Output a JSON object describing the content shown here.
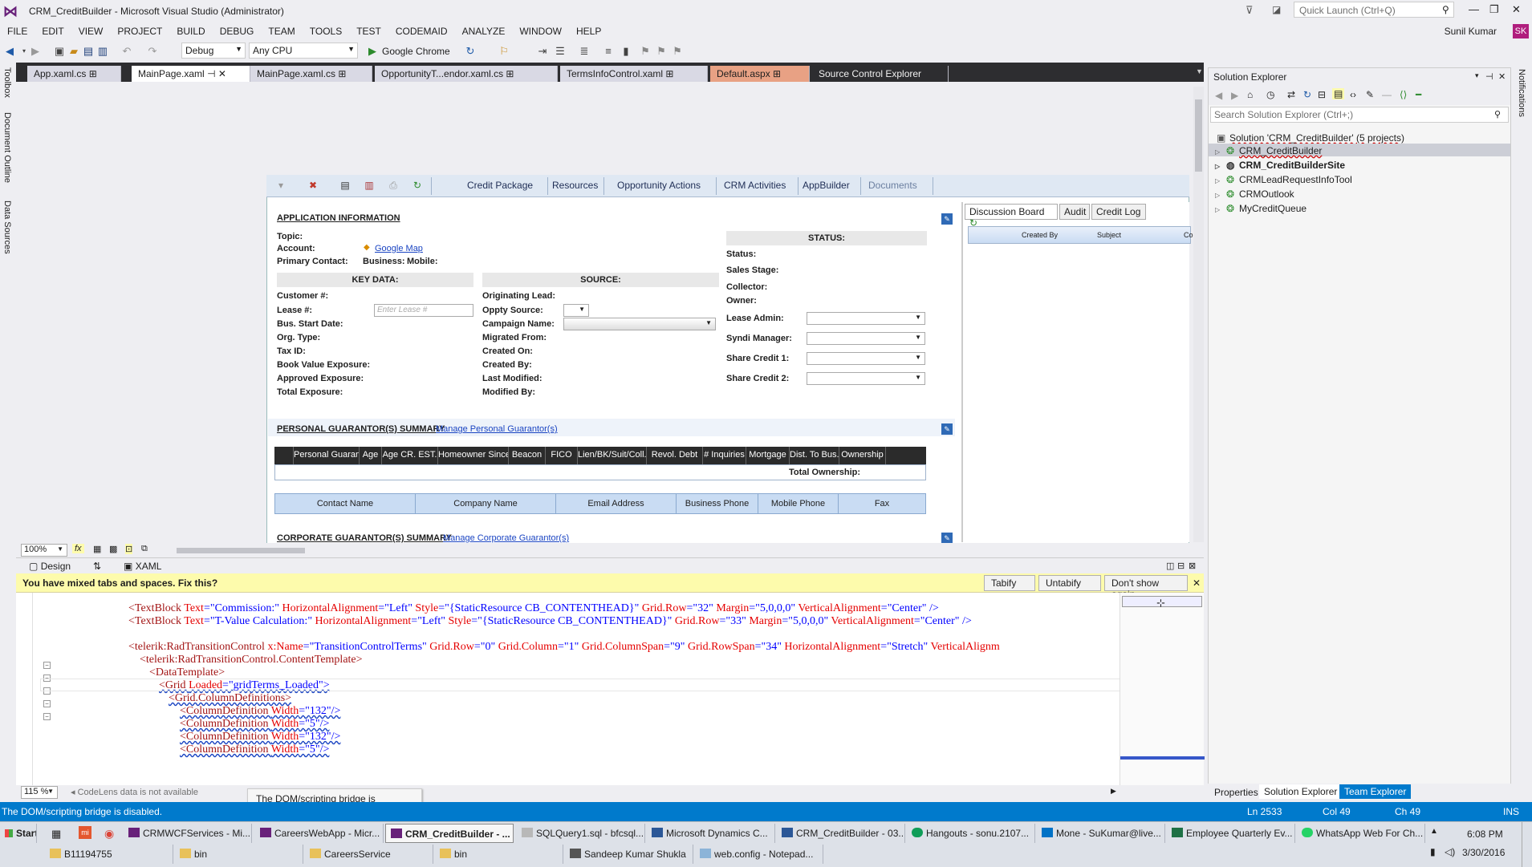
{
  "window": {
    "title": "CRM_CreditBuilder - Microsoft Visual Studio (Administrator)",
    "quick_launch_placeholder": "Quick Launch (Ctrl+Q)",
    "user": "Sunil Kumar",
    "user_initials": "SK"
  },
  "menu": [
    "FILE",
    "EDIT",
    "VIEW",
    "PROJECT",
    "BUILD",
    "DEBUG",
    "TEAM",
    "TOOLS",
    "TEST",
    "CODEMAID",
    "ANALYZE",
    "WINDOW",
    "HELP"
  ],
  "toolbar": {
    "config": "Debug",
    "platform": "Any CPU",
    "run_target": "Google Chrome"
  },
  "left_strip": [
    "Toolbox",
    "Document Outline",
    "Data Sources"
  ],
  "right_strip": [
    "Notifications"
  ],
  "doc_tabs": [
    "App.xaml.cs",
    "MainPage.xaml",
    "MainPage.xaml.cs",
    "OpportunityT...endor.xaml.cs",
    "TermsInfoControl.xaml",
    "Default.aspx",
    "Source Control Explorer"
  ],
  "ribbon": [
    "Credit Package",
    "Resources",
    "Opportunity Actions",
    "CRM Activities",
    "AppBuilder",
    "Documents"
  ],
  "app_info": {
    "title": "APPLICATION INFORMATION",
    "topic": "Topic:",
    "account": "Account:",
    "google_map": "Google Map",
    "primary_contact": "Primary Contact:",
    "business": "Business:",
    "mobile": "Mobile:",
    "status_header": "STATUS:",
    "status_fields": [
      "Status:",
      "Sales Stage:",
      "Collector:",
      "Owner:",
      "Lease Admin:",
      "Syndi Manager:",
      "Share Credit 1:",
      "Share Credit 2:"
    ],
    "key_data_header": "KEY DATA:",
    "key_data_fields": [
      "Customer #:",
      "Lease #:",
      "Bus. Start Date:",
      "Org. Type:",
      "Tax ID:",
      "Book Value Exposure:",
      "Approved Exposure:",
      "Total Exposure:"
    ],
    "lease_placeholder": "Enter Lease #",
    "source_header": "SOURCE:",
    "source_fields": [
      "Originating Lead:",
      "Oppty Source:",
      "Campaign Name:",
      "Migrated From:",
      "Created On:",
      "Created By:",
      "Last Modified:",
      "Modified By:"
    ]
  },
  "guarantors": {
    "personal_title": "PERSONAL GUARANTOR(S) SUMMARY",
    "personal_link": "Manage Personal Guarantor(s)",
    "personal_cols": [
      "Personal Guarantor",
      "Age",
      "Age CR. EST.",
      "Homeowner Since",
      "Beacon",
      "FICO",
      "Lien/BK/Suit/Coll.",
      "Revol. Debt",
      "# Inquiries",
      "Mortgage",
      "Dist. To Bus.",
      "Ownership"
    ],
    "total_ownership": "Total Ownership:",
    "contact_cols": [
      "Contact Name",
      "Company Name",
      "Email Address",
      "Business Phone",
      "Mobile Phone",
      "Fax"
    ],
    "corporate_title": "CORPORATE GUARANTOR(S) SUMMARY",
    "corporate_link": "Manage Corporate Guarantor(s)"
  },
  "right_panel": {
    "tabs": [
      "Discussion Board",
      "Audit",
      "Credit Log"
    ],
    "cols": [
      "Created By",
      "Subject",
      "Co"
    ]
  },
  "designer": {
    "zoom": "100%",
    "design_tab": "Design",
    "xaml_tab": "XAML"
  },
  "infobar": {
    "message": "You have mixed tabs and spaces. Fix this?",
    "tabify": "Tabify",
    "untabify": "Untabify",
    "dont_show": "Don't show again"
  },
  "code_lines": [
    {
      "indent": 140,
      "parts": [
        [
          "tg",
          "<TextBlock "
        ],
        [
          "at",
          "Text"
        ],
        [
          "bl",
          "=\""
        ],
        [
          "vl",
          "Commission:"
        ],
        [
          "bl",
          "\" "
        ],
        [
          "at",
          "HorizontalAlignment"
        ],
        [
          "bl",
          "=\""
        ],
        [
          "vl",
          "Left"
        ],
        [
          "bl",
          "\" "
        ],
        [
          "at",
          "Style"
        ],
        [
          "bl",
          "=\""
        ],
        [
          "vl",
          "{StaticResource CB_CONTENTHEAD}"
        ],
        [
          "bl",
          "\" "
        ],
        [
          "at",
          "Grid.Row"
        ],
        [
          "bl",
          "=\""
        ],
        [
          "vl",
          "32"
        ],
        [
          "bl",
          "\" "
        ],
        [
          "at",
          "Margin"
        ],
        [
          "bl",
          "=\""
        ],
        [
          "vl",
          "5,0,0,0"
        ],
        [
          "bl",
          "\" "
        ],
        [
          "at",
          "VerticalAlignment"
        ],
        [
          "bl",
          "=\""
        ],
        [
          "vl",
          "Center"
        ],
        [
          "bl",
          "\" />"
        ]
      ]
    },
    {
      "indent": 140,
      "parts": [
        [
          "tg",
          "<TextBlock "
        ],
        [
          "at",
          "Text"
        ],
        [
          "bl",
          "=\""
        ],
        [
          "vl",
          "T-Value Calculation:"
        ],
        [
          "bl",
          "\" "
        ],
        [
          "at",
          "HorizontalAlignment"
        ],
        [
          "bl",
          "=\""
        ],
        [
          "vl",
          "Left"
        ],
        [
          "bl",
          "\" "
        ],
        [
          "at",
          "Style"
        ],
        [
          "bl",
          "=\""
        ],
        [
          "vl",
          "{StaticResource CB_CONTENTHEAD}"
        ],
        [
          "bl",
          "\" "
        ],
        [
          "at",
          "Grid.Row"
        ],
        [
          "bl",
          "=\""
        ],
        [
          "vl",
          "33"
        ],
        [
          "bl",
          "\" "
        ],
        [
          "at",
          "Margin"
        ],
        [
          "bl",
          "=\""
        ],
        [
          "vl",
          "5,0,0,0"
        ],
        [
          "bl",
          "\" "
        ],
        [
          "at",
          "VerticalAlignment"
        ],
        [
          "bl",
          "=\""
        ],
        [
          "vl",
          "Center"
        ],
        [
          "bl",
          "\" />"
        ]
      ]
    },
    {
      "indent": 140,
      "parts": []
    },
    {
      "indent": 140,
      "parts": [
        [
          "tg",
          "<telerik:RadTransitionControl "
        ],
        [
          "at",
          "x:Name"
        ],
        [
          "bl",
          "=\""
        ],
        [
          "vl",
          "TransitionControlTerms"
        ],
        [
          "bl",
          "\" "
        ],
        [
          "at",
          "Grid.Row"
        ],
        [
          "bl",
          "=\""
        ],
        [
          "vl",
          "0"
        ],
        [
          "bl",
          "\" "
        ],
        [
          "at",
          "Grid.Column"
        ],
        [
          "bl",
          "=\""
        ],
        [
          "vl",
          "1"
        ],
        [
          "bl",
          "\" "
        ],
        [
          "at",
          "Grid.ColumnSpan"
        ],
        [
          "bl",
          "=\""
        ],
        [
          "vl",
          "9"
        ],
        [
          "bl",
          "\" "
        ],
        [
          "at",
          "Grid.RowSpan"
        ],
        [
          "bl",
          "=\""
        ],
        [
          "vl",
          "34"
        ],
        [
          "bl",
          "\" "
        ],
        [
          "at",
          "HorizontalAlignment"
        ],
        [
          "bl",
          "=\""
        ],
        [
          "vl",
          "Stretch"
        ],
        [
          "bl",
          "\" "
        ],
        [
          "at",
          "VerticalAlignm"
        ]
      ]
    },
    {
      "indent": 154,
      "parts": [
        [
          "tg",
          "<telerik:RadTransitionControl.ContentTemplate>"
        ]
      ]
    },
    {
      "indent": 166,
      "parts": [
        [
          "tg",
          "<DataTemplate>"
        ]
      ]
    },
    {
      "indent": 178,
      "parts": [
        [
          "tg",
          "<Grid "
        ],
        [
          "at",
          "Loaded"
        ],
        [
          "bl",
          "=\""
        ],
        [
          "vl",
          "gridTerms_Loaded"
        ],
        [
          "bl",
          "\">"
        ]
      ]
    },
    {
      "indent": 190,
      "parts": [
        [
          "tg",
          "<Grid.ColumnDefinitions>"
        ]
      ]
    },
    {
      "indent": 204,
      "parts": [
        [
          "tg",
          "<ColumnDefinition "
        ],
        [
          "at",
          "Width"
        ],
        [
          "bl",
          "=\""
        ],
        [
          "vl",
          "132"
        ],
        [
          "bl",
          "\"/>"
        ]
      ]
    },
    {
      "indent": 204,
      "parts": [
        [
          "tg",
          "<ColumnDefinition "
        ],
        [
          "at",
          "Width"
        ],
        [
          "bl",
          "=\""
        ],
        [
          "vl",
          "5"
        ],
        [
          "bl",
          "\"/>"
        ]
      ]
    },
    {
      "indent": 204,
      "parts": [
        [
          "tg",
          "<ColumnDefinition "
        ],
        [
          "at",
          "Width"
        ],
        [
          "bl",
          "=\""
        ],
        [
          "vl",
          "132"
        ],
        [
          "bl",
          "\"/>"
        ]
      ]
    },
    {
      "indent": 204,
      "parts": [
        [
          "tg",
          "<ColumnDefinition "
        ],
        [
          "at",
          "Width"
        ],
        [
          "bl",
          "=\""
        ],
        [
          "vl",
          "5"
        ],
        [
          "bl",
          "\"/>"
        ]
      ]
    }
  ],
  "code_footer": {
    "zoom": "115 %",
    "codelens": "CodeLens data is not available"
  },
  "tooltip": "The DOM/scripting bridge is disabled.",
  "solution_explorer": {
    "title": "Solution Explorer",
    "search_placeholder": "Search Solution Explorer (Ctrl+;)",
    "solution": "Solution 'CRM_CreditBuilder' (5 projects)",
    "projects": [
      "CRM_CreditBuilder",
      "CRM_CreditBuilderSite",
      "CRMLeadRequestInfoTool",
      "CRMOutlook",
      "MyCreditQueue"
    ],
    "bottom_tabs": [
      "Properties",
      "Solution Explorer",
      "Team Explorer"
    ]
  },
  "status_bar": {
    "message": "The DOM/scripting bridge is disabled.",
    "line": "Ln 2533",
    "col": "Col 49",
    "ch": "Ch 49",
    "mode": "INS"
  },
  "taskbar": {
    "start": "Start",
    "row1": [
      "CRMWCFServices - Mi...",
      "CareersWebApp - Micr...",
      "CRM_CreditBuilder - ...",
      "SQLQuery1.sql - bfcsql...",
      "Microsoft Dynamics C...",
      "CRM_CreditBuilder - 03...",
      "Hangouts - sonu.2107...",
      "Mone - SuKumar@live...",
      "Employee Quarterly Ev...",
      "WhatsApp Web For Ch..."
    ],
    "row2": [
      "B11194755",
      "bin",
      "CareersService",
      "bin",
      "Sandeep Kumar Shukla",
      "web.config - Notepad..."
    ],
    "time": "6:08 PM",
    "date": "3/30/2016"
  }
}
